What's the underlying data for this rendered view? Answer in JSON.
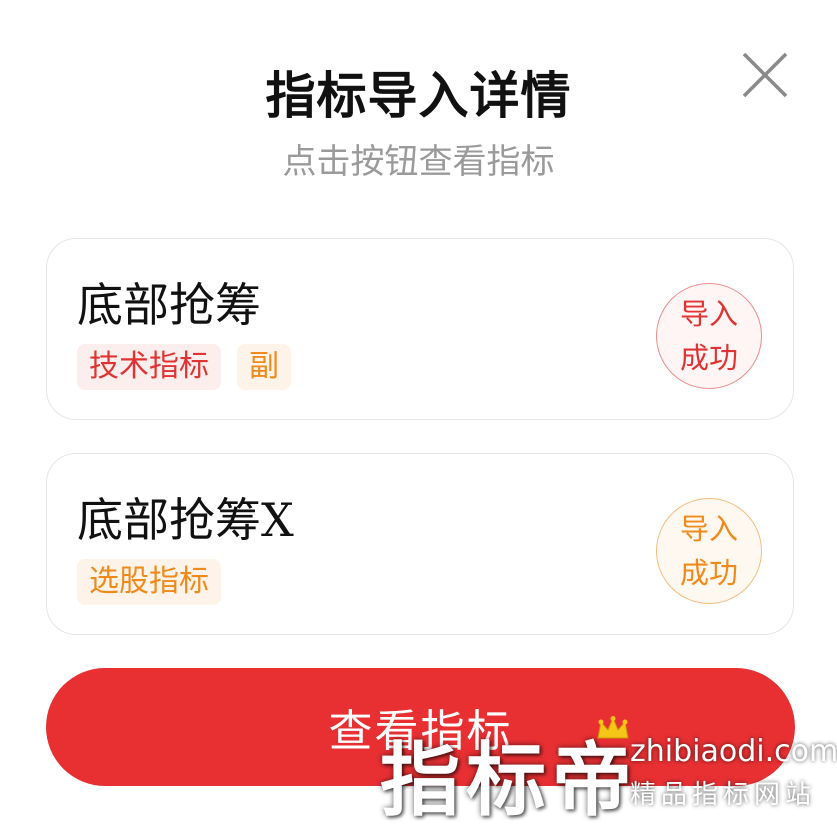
{
  "dialog": {
    "title": "指标导入详情",
    "subtitle": "点击按钮查看指标"
  },
  "items": [
    {
      "name": "底部抢筹",
      "tags": [
        {
          "label": "技术指标",
          "color": "#e03434"
        },
        {
          "label": "副",
          "color": "#f08a1c"
        }
      ],
      "status_line1": "导入",
      "status_line2": "成功",
      "status_color": "#e03434"
    },
    {
      "name": "底部抢筹X",
      "tags": [
        {
          "label": "选股指标",
          "color": "#f08a1c"
        }
      ],
      "status_line1": "导入",
      "status_line2": "成功",
      "status_color": "#f08a1c"
    }
  ],
  "actions": {
    "view_label": "查看指标"
  },
  "watermark": {
    "brand": "指标帝",
    "url": "zhibiaodi.com",
    "slogan": "精品指标网站"
  },
  "colors": {
    "primary_button": "#e83033",
    "tag_red": "#e03434",
    "tag_orange": "#f08a1c"
  },
  "icons": {
    "close": "close-icon",
    "crown": "crown-icon"
  }
}
